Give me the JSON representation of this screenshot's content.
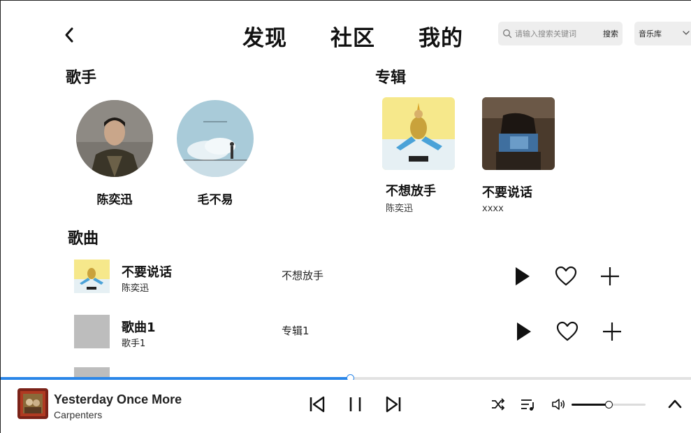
{
  "header": {
    "tabs": [
      "发现",
      "社区",
      "我的"
    ],
    "search_placeholder": "请输入搜索关键词",
    "search_button": "搜索",
    "library_select": "音乐库"
  },
  "singers": {
    "title": "歌手",
    "items": [
      {
        "name": "陈奕迅"
      },
      {
        "name": "毛不易"
      }
    ]
  },
  "albums": {
    "title": "专辑",
    "items": [
      {
        "title": "不想放手",
        "artist": "陈奕迅"
      },
      {
        "title": "不要说话",
        "artist": "xxxx"
      }
    ]
  },
  "songs": {
    "title": "歌曲",
    "items": [
      {
        "title": "不要说话",
        "artist": "陈奕迅",
        "album": "不想放手"
      },
      {
        "title": "歌曲1",
        "artist": "歌手1",
        "album": "专辑1"
      }
    ]
  },
  "player": {
    "title": "Yesterday Once More",
    "artist": "Carpenters",
    "progress": 0.506,
    "volume": 0.5
  },
  "colors": {
    "accent": "#2a86e8",
    "placeholder_thumb": "#bdbdbd",
    "search_bg": "#eeeeee"
  }
}
